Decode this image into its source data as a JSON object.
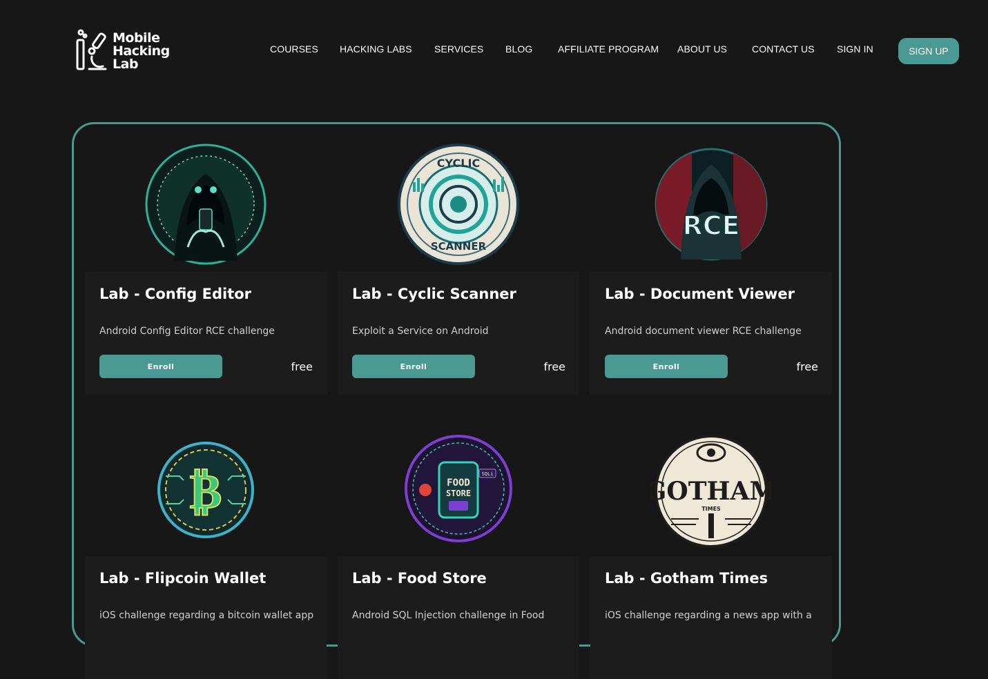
{
  "header": {
    "logo": {
      "line1": "Mobile",
      "line2": "Hacking",
      "line3": "Lab"
    },
    "nav": [
      {
        "label": "COURSES"
      },
      {
        "label": "HACKING LABS"
      },
      {
        "label": "SERVICES"
      },
      {
        "label": "BLOG"
      },
      {
        "label": "AFFILIATE PROGRAM"
      },
      {
        "label": "ABOUT US"
      },
      {
        "label": "CONTACT US"
      },
      {
        "label": "SIGN IN"
      }
    ],
    "signup_label": "SIGN UP"
  },
  "colors": {
    "accent": "#4a9a93",
    "background": "#171717",
    "card": "#1c1c1c"
  },
  "labs": [
    {
      "title": "Lab - Config Editor",
      "description": "Android Config Editor RCE challenge",
      "enroll_label": "Enroll",
      "price": "free",
      "image_icon": "hooded-hacker-badge-icon"
    },
    {
      "title": "Lab - Cyclic Scanner",
      "description": "Exploit a Service on Android",
      "enroll_label": "Enroll",
      "price": "free",
      "image_icon": "cyclic-scanner-badge-icon",
      "badge_top": "CYCLIC",
      "badge_bottom": "SCANNER"
    },
    {
      "title": "Lab - Document Viewer",
      "description": "Android document viewer RCE challenge",
      "enroll_label": "Enroll",
      "price": "free",
      "image_icon": "rce-hacker-badge-icon",
      "badge_text": "RCE"
    },
    {
      "title": "Lab - Flipcoin Wallet",
      "description": "iOS challenge regarding a bitcoin wallet app",
      "image_icon": "bitcoin-coin-icon"
    },
    {
      "title": "Lab - Food Store",
      "description": "Android SQL Injection challenge in Food",
      "image_icon": "food-store-badge-icon",
      "badge_top": "FOOD",
      "badge_bottom": "STORE",
      "badge_tag": "SQLi"
    },
    {
      "title": "Lab - Gotham Times",
      "description": "iOS challenge regarding a news app with a",
      "image_icon": "gotham-times-badge-icon",
      "badge_text": "GOTHAM",
      "badge_sub": "TIMES"
    }
  ]
}
